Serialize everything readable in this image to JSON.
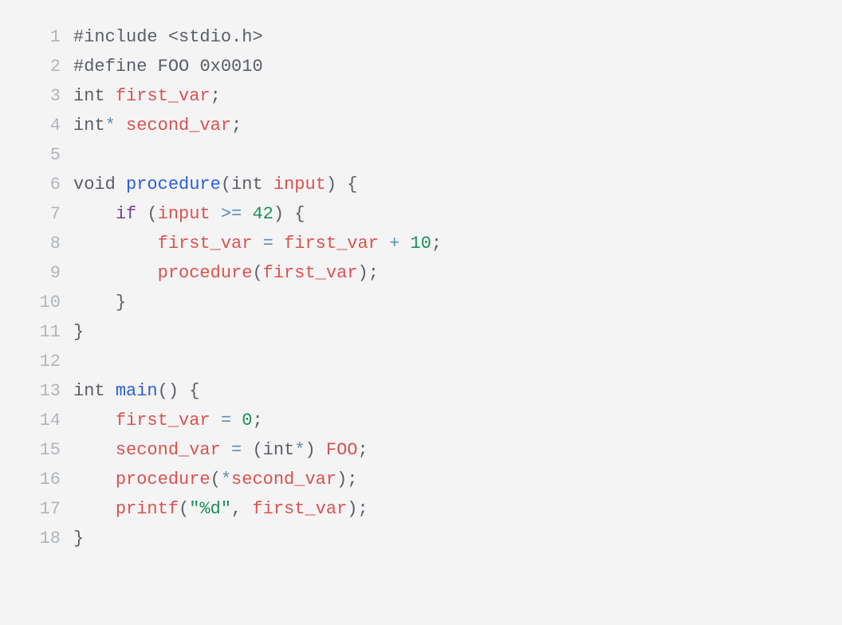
{
  "code": {
    "language": "c",
    "lines": [
      {
        "num": "1",
        "tokens": [
          {
            "cls": "tok-preproc",
            "text": "#include"
          },
          {
            "cls": "tok-default",
            "text": " "
          },
          {
            "cls": "tok-preproc",
            "text": "<stdio.h>"
          }
        ]
      },
      {
        "num": "2",
        "tokens": [
          {
            "cls": "tok-preproc",
            "text": "#define"
          },
          {
            "cls": "tok-default",
            "text": " "
          },
          {
            "cls": "tok-preproc",
            "text": "FOO"
          },
          {
            "cls": "tok-default",
            "text": " "
          },
          {
            "cls": "tok-preproc",
            "text": "0x0010"
          }
        ]
      },
      {
        "num": "3",
        "tokens": [
          {
            "cls": "tok-type",
            "text": "int"
          },
          {
            "cls": "tok-default",
            "text": " "
          },
          {
            "cls": "tok-ident",
            "text": "first_var"
          },
          {
            "cls": "tok-punct",
            "text": ";"
          }
        ]
      },
      {
        "num": "4",
        "tokens": [
          {
            "cls": "tok-type",
            "text": "int"
          },
          {
            "cls": "tok-star",
            "text": "*"
          },
          {
            "cls": "tok-default",
            "text": " "
          },
          {
            "cls": "tok-ident",
            "text": "second_var"
          },
          {
            "cls": "tok-punct",
            "text": ";"
          }
        ]
      },
      {
        "num": "5",
        "tokens": [
          {
            "cls": "tok-default",
            "text": " "
          }
        ]
      },
      {
        "num": "6",
        "tokens": [
          {
            "cls": "tok-type",
            "text": "void"
          },
          {
            "cls": "tok-default",
            "text": " "
          },
          {
            "cls": "tok-funcdef",
            "text": "procedure"
          },
          {
            "cls": "tok-punct",
            "text": "("
          },
          {
            "cls": "tok-type",
            "text": "int"
          },
          {
            "cls": "tok-default",
            "text": " "
          },
          {
            "cls": "tok-ident",
            "text": "input"
          },
          {
            "cls": "tok-punct",
            "text": ")"
          },
          {
            "cls": "tok-default",
            "text": " "
          },
          {
            "cls": "tok-punct",
            "text": "{"
          }
        ]
      },
      {
        "num": "7",
        "tokens": [
          {
            "cls": "tok-default",
            "text": "    "
          },
          {
            "cls": "tok-kwctrl",
            "text": "if"
          },
          {
            "cls": "tok-default",
            "text": " "
          },
          {
            "cls": "tok-punct",
            "text": "("
          },
          {
            "cls": "tok-ident",
            "text": "input"
          },
          {
            "cls": "tok-default",
            "text": " "
          },
          {
            "cls": "tok-op",
            "text": ">="
          },
          {
            "cls": "tok-default",
            "text": " "
          },
          {
            "cls": "tok-number",
            "text": "42"
          },
          {
            "cls": "tok-punct",
            "text": ")"
          },
          {
            "cls": "tok-default",
            "text": " "
          },
          {
            "cls": "tok-punct",
            "text": "{"
          }
        ]
      },
      {
        "num": "8",
        "tokens": [
          {
            "cls": "tok-default",
            "text": "        "
          },
          {
            "cls": "tok-ident",
            "text": "first_var"
          },
          {
            "cls": "tok-default",
            "text": " "
          },
          {
            "cls": "tok-op",
            "text": "="
          },
          {
            "cls": "tok-default",
            "text": " "
          },
          {
            "cls": "tok-ident",
            "text": "first_var"
          },
          {
            "cls": "tok-default",
            "text": " "
          },
          {
            "cls": "tok-op",
            "text": "+"
          },
          {
            "cls": "tok-default",
            "text": " "
          },
          {
            "cls": "tok-number",
            "text": "10"
          },
          {
            "cls": "tok-punct",
            "text": ";"
          }
        ]
      },
      {
        "num": "9",
        "tokens": [
          {
            "cls": "tok-default",
            "text": "        "
          },
          {
            "cls": "tok-ident",
            "text": "procedure"
          },
          {
            "cls": "tok-punct",
            "text": "("
          },
          {
            "cls": "tok-ident",
            "text": "first_var"
          },
          {
            "cls": "tok-punct",
            "text": ")"
          },
          {
            "cls": "tok-punct",
            "text": ";"
          }
        ]
      },
      {
        "num": "10",
        "tokens": [
          {
            "cls": "tok-default",
            "text": "    "
          },
          {
            "cls": "tok-punct",
            "text": "}"
          }
        ]
      },
      {
        "num": "11",
        "tokens": [
          {
            "cls": "tok-punct",
            "text": "}"
          }
        ]
      },
      {
        "num": "12",
        "tokens": [
          {
            "cls": "tok-default",
            "text": " "
          }
        ]
      },
      {
        "num": "13",
        "tokens": [
          {
            "cls": "tok-type",
            "text": "int"
          },
          {
            "cls": "tok-default",
            "text": " "
          },
          {
            "cls": "tok-funcdef",
            "text": "main"
          },
          {
            "cls": "tok-punct",
            "text": "("
          },
          {
            "cls": "tok-punct",
            "text": ")"
          },
          {
            "cls": "tok-default",
            "text": " "
          },
          {
            "cls": "tok-punct",
            "text": "{"
          }
        ]
      },
      {
        "num": "14",
        "tokens": [
          {
            "cls": "tok-default",
            "text": "    "
          },
          {
            "cls": "tok-ident",
            "text": "first_var"
          },
          {
            "cls": "tok-default",
            "text": " "
          },
          {
            "cls": "tok-op",
            "text": "="
          },
          {
            "cls": "tok-default",
            "text": " "
          },
          {
            "cls": "tok-number",
            "text": "0"
          },
          {
            "cls": "tok-punct",
            "text": ";"
          }
        ]
      },
      {
        "num": "15",
        "tokens": [
          {
            "cls": "tok-default",
            "text": "    "
          },
          {
            "cls": "tok-ident",
            "text": "second_var"
          },
          {
            "cls": "tok-default",
            "text": " "
          },
          {
            "cls": "tok-op",
            "text": "="
          },
          {
            "cls": "tok-default",
            "text": " "
          },
          {
            "cls": "tok-punct",
            "text": "("
          },
          {
            "cls": "tok-type",
            "text": "int"
          },
          {
            "cls": "tok-star",
            "text": "*"
          },
          {
            "cls": "tok-punct",
            "text": ")"
          },
          {
            "cls": "tok-default",
            "text": " "
          },
          {
            "cls": "tok-ident",
            "text": "FOO"
          },
          {
            "cls": "tok-punct",
            "text": ";"
          }
        ]
      },
      {
        "num": "16",
        "tokens": [
          {
            "cls": "tok-default",
            "text": "    "
          },
          {
            "cls": "tok-ident",
            "text": "procedure"
          },
          {
            "cls": "tok-punct",
            "text": "("
          },
          {
            "cls": "tok-star",
            "text": "*"
          },
          {
            "cls": "tok-ident",
            "text": "second_var"
          },
          {
            "cls": "tok-punct",
            "text": ")"
          },
          {
            "cls": "tok-punct",
            "text": ";"
          }
        ]
      },
      {
        "num": "17",
        "tokens": [
          {
            "cls": "tok-default",
            "text": "    "
          },
          {
            "cls": "tok-ident",
            "text": "printf"
          },
          {
            "cls": "tok-punct",
            "text": "("
          },
          {
            "cls": "tok-string",
            "text": "\"%d\""
          },
          {
            "cls": "tok-punct",
            "text": ","
          },
          {
            "cls": "tok-default",
            "text": " "
          },
          {
            "cls": "tok-ident",
            "text": "first_var"
          },
          {
            "cls": "tok-punct",
            "text": ")"
          },
          {
            "cls": "tok-punct",
            "text": ";"
          }
        ]
      },
      {
        "num": "18",
        "tokens": [
          {
            "cls": "tok-punct",
            "text": "}"
          }
        ]
      }
    ]
  }
}
